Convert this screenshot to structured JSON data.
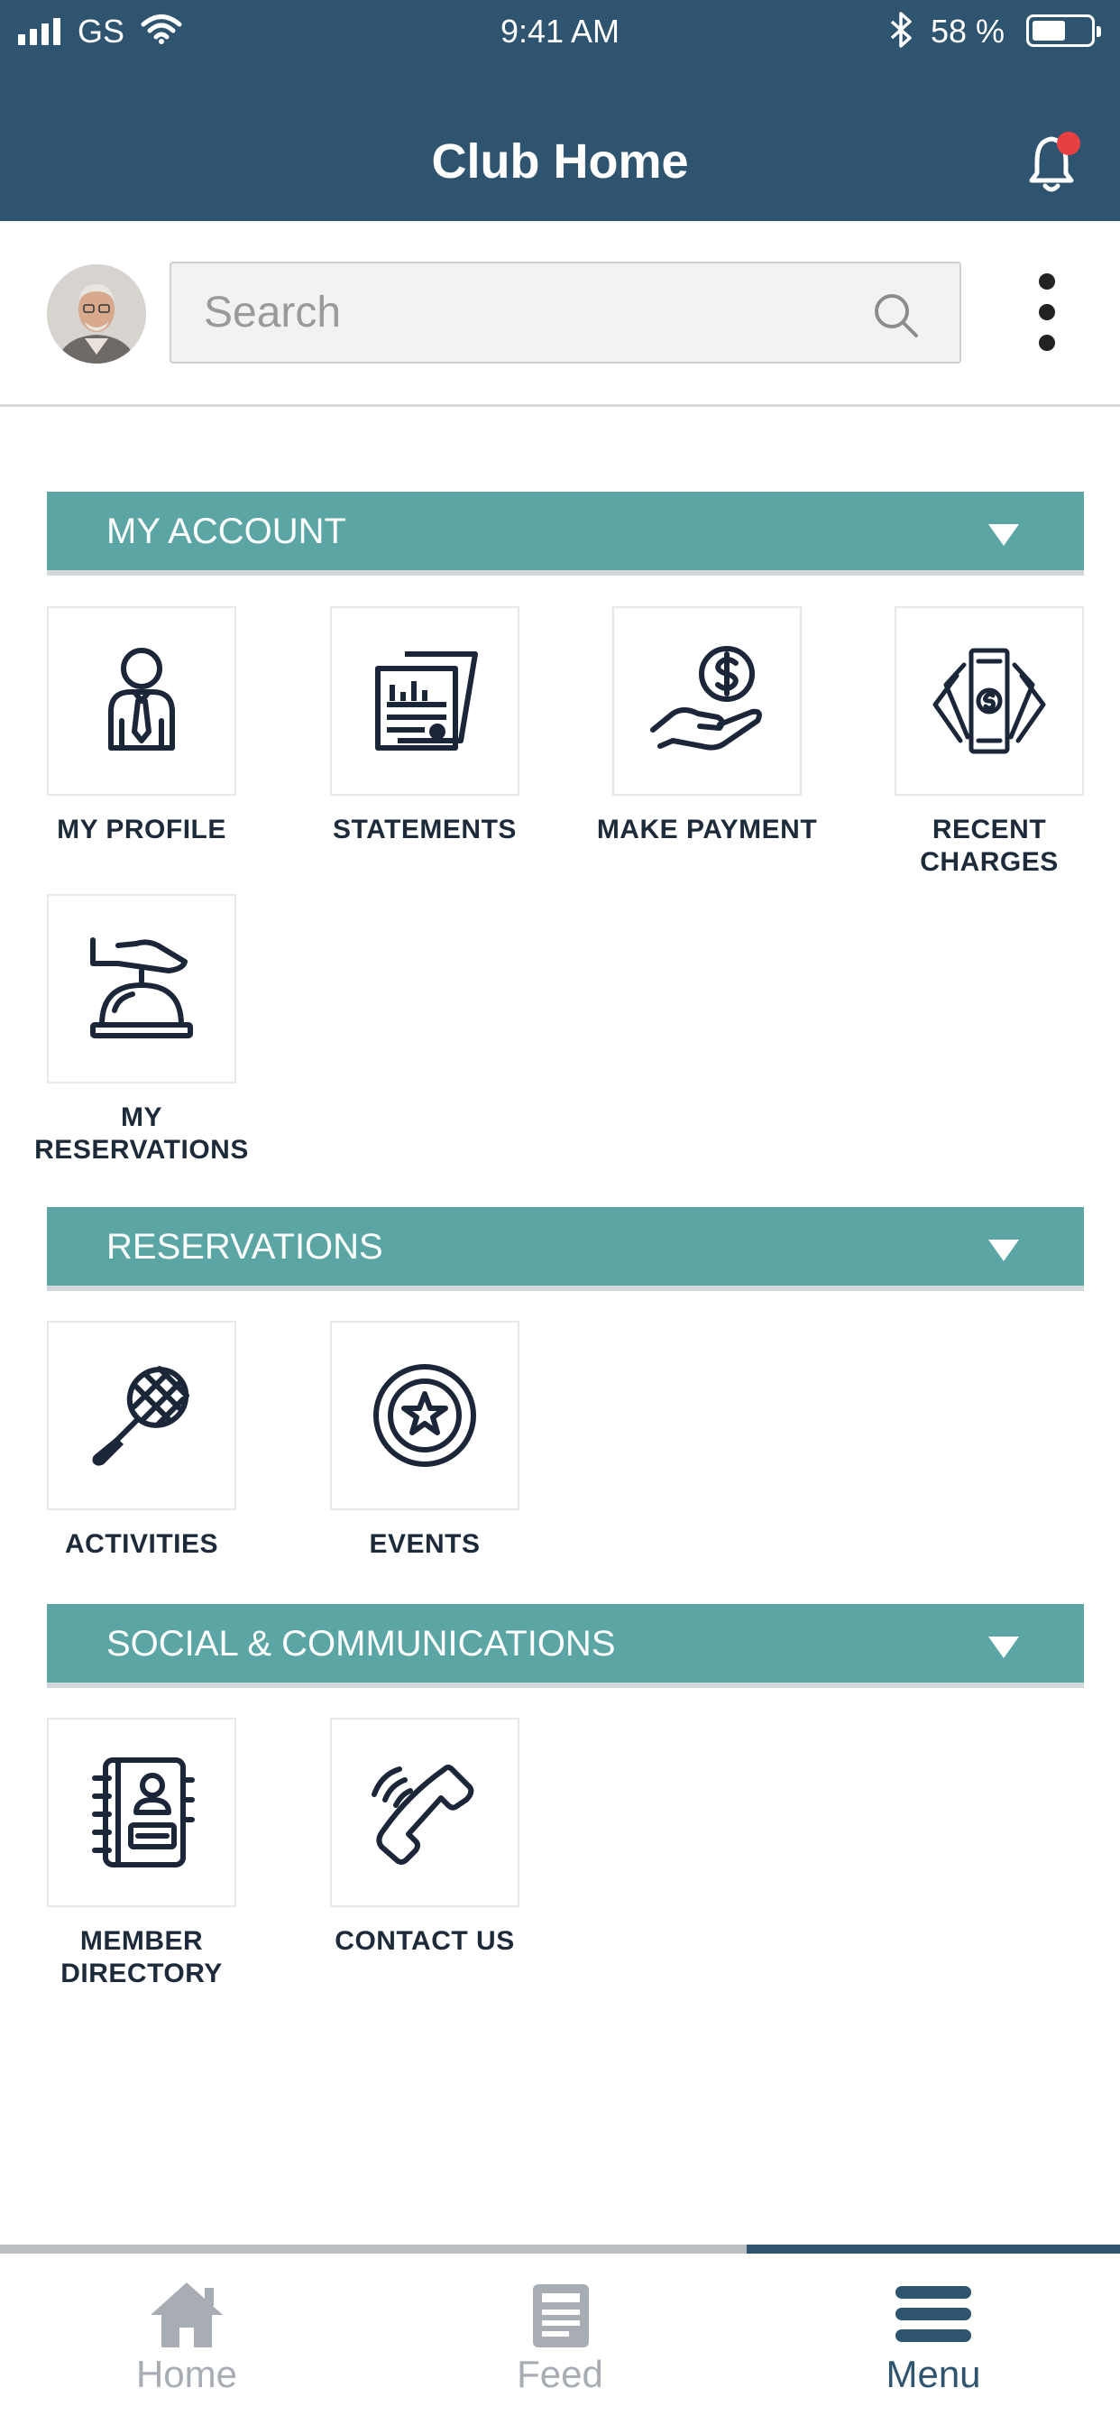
{
  "status_bar": {
    "carrier": "GS",
    "time": "9:41 AM",
    "battery_percent": "58 %",
    "battery_level": 0.58
  },
  "header": {
    "title": "Club Home"
  },
  "search": {
    "placeholder": "Search"
  },
  "sections": [
    {
      "title": "MY ACCOUNT",
      "tiles": [
        {
          "label": "MY PROFILE",
          "icon": "member-profile-icon"
        },
        {
          "label": "STATEMENTS",
          "icon": "statements-icon"
        },
        {
          "label": "MAKE PAYMENT",
          "icon": "hand-dollar-icon"
        },
        {
          "label_lines": [
            "RECENT",
            "CHARGES"
          ],
          "icon": "cash-fan-icon"
        },
        {
          "label_lines": [
            "MY",
            "RESERVATIONS"
          ],
          "icon": "service-bell-icon"
        }
      ]
    },
    {
      "title": "RESERVATIONS",
      "tiles": [
        {
          "label": "ACTIVITIES",
          "icon": "tennis-racket-icon"
        },
        {
          "label": "EVENTS",
          "icon": "star-badge-icon"
        }
      ]
    },
    {
      "title": "SOCIAL & COMMUNICATIONS",
      "tiles": [
        {
          "label_lines": [
            "MEMBER",
            "DIRECTORY"
          ],
          "icon": "address-book-icon"
        },
        {
          "label": "CONTACT US",
          "icon": "phone-icon"
        }
      ]
    }
  ],
  "bottom_nav": {
    "items": [
      {
        "label": "Home",
        "icon": "home-icon"
      },
      {
        "label": "Feed",
        "icon": "feed-icon"
      },
      {
        "label": "Menu",
        "icon": "menu-icon"
      }
    ],
    "active": "Menu"
  },
  "colors": {
    "header_bg": "#2f546f",
    "section_bar": "#5ba5a5",
    "icon_dark": "#1b2638",
    "nav_active": "#2f546f",
    "nav_inactive": "#a7adb3",
    "notification_dot": "#e84040"
  }
}
